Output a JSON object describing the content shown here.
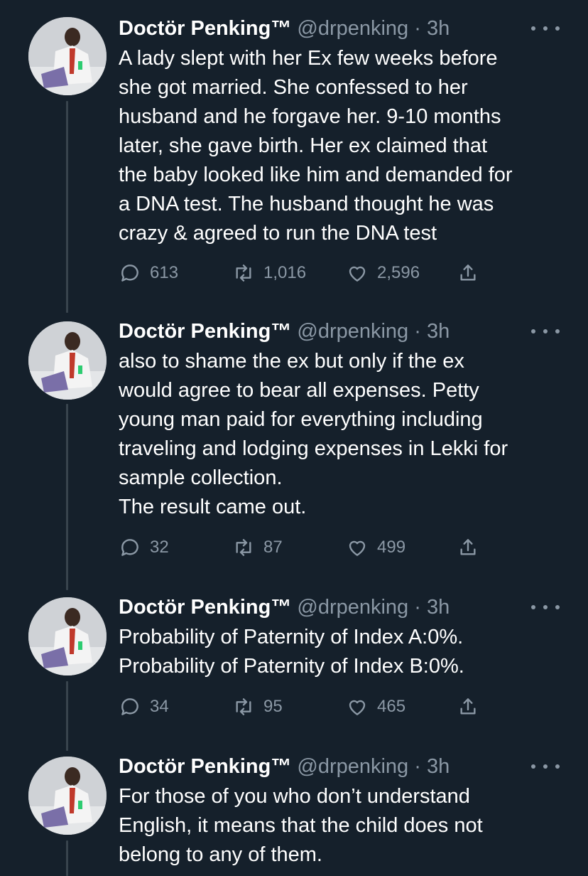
{
  "colors": {
    "background": "#15202b",
    "text": "#ffffff",
    "secondary": "#8b98a5",
    "thread_line": "#38444d"
  },
  "tweets": [
    {
      "name": "Doctör Penking™",
      "handle_time": "@drpenking · 3h",
      "text": "A lady slept with her Ex few weeks before\nshe got married. She confessed to her\nhusband and he forgave her. 9-10 months\nlater, she gave birth. Her ex claimed that\nthe baby looked like him and demanded for\na DNA test. The husband thought he was\ncrazy & agreed to run the DNA test",
      "replies": "613",
      "retweets": "1,016",
      "likes": "2,596"
    },
    {
      "name": "Doctör Penking™",
      "handle_time": "@drpenking · 3h",
      "text": "also to shame the ex but only if the ex\nwould agree to bear all expenses. Petty\nyoung man paid for everything including\ntraveling and lodging expenses in Lekki for\nsample collection.\nThe result came out.",
      "replies": "32",
      "retweets": "87",
      "likes": "499"
    },
    {
      "name": "Doctör Penking™",
      "handle_time": "@drpenking · 3h",
      "text": "Probability of Paternity of Index A:0%.\nProbability of Paternity of Index B:0%.",
      "replies": "34",
      "retweets": "95",
      "likes": "465"
    },
    {
      "name": "Doctör Penking™",
      "handle_time": "@drpenking · 3h",
      "text": "For those of you who don’t understand\nEnglish, it means that the child does not\nbelong to any of them."
    }
  ]
}
